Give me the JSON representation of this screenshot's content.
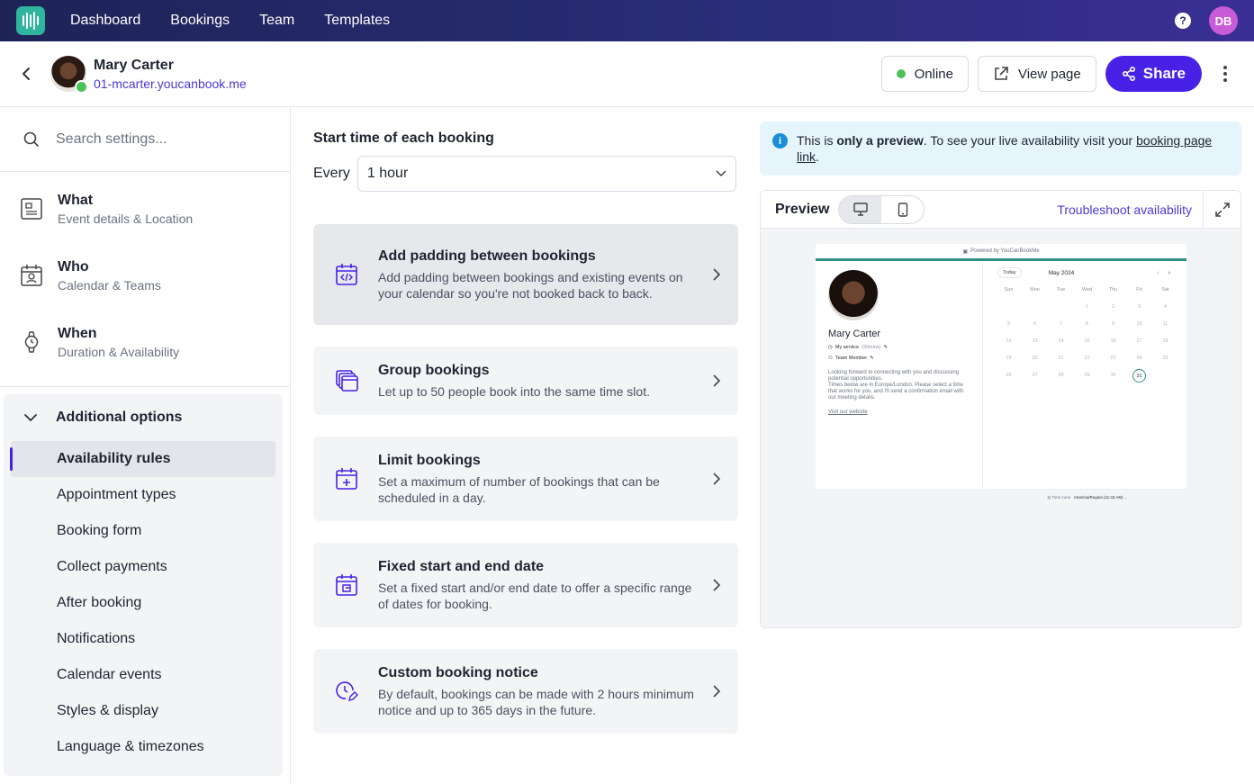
{
  "nav": {
    "links": [
      "Dashboard",
      "Bookings",
      "Team",
      "Templates"
    ],
    "help_icon": "question-circle-icon",
    "user_initials": "DB"
  },
  "header": {
    "name": "Mary Carter",
    "url": "01-mcarter.youcanbook.me",
    "online_label": "Online",
    "view_page_label": "View page",
    "share_label": "Share"
  },
  "sidebar": {
    "search_placeholder": "Search settings...",
    "sections": [
      {
        "title": "What",
        "subtitle": "Event details & Location",
        "icon": "document-icon"
      },
      {
        "title": "Who",
        "subtitle": "Calendar & Teams",
        "icon": "calendar-person-icon"
      },
      {
        "title": "When",
        "subtitle": "Duration & Availability",
        "icon": "watch-icon"
      }
    ],
    "additional_title": "Additional options",
    "options": [
      "Availability rules",
      "Appointment types",
      "Booking form",
      "Collect payments",
      "After booking",
      "Notifications",
      "Calendar events",
      "Styles & display",
      "Language & timezones"
    ],
    "active_option": "Availability rules"
  },
  "main": {
    "start_time_label": "Start time of each booking",
    "every_label": "Every",
    "every_value": "1 hour",
    "cards": [
      {
        "title": "Add padding between bookings",
        "desc": "Add padding between bookings and existing events on your calendar so you're not booked back to back.",
        "icon": "calendar-code-icon"
      },
      {
        "title": "Group bookings",
        "desc": "Let up to 50 people book into the same time slot.",
        "icon": "calendar-stack-icon"
      },
      {
        "title": "Limit bookings",
        "desc": "Set a maximum of number of bookings that can be scheduled in a day.",
        "icon": "calendar-plus-icon"
      },
      {
        "title": "Fixed start and end date",
        "desc": "Set a fixed start and/or end date to offer a specific range of dates for booking.",
        "icon": "calendar-range-icon"
      },
      {
        "title": "Custom booking notice",
        "desc": "By default, bookings can be made with 2 hours minimum notice and up to 365 days in the future.",
        "icon": "clock-edit-icon"
      }
    ]
  },
  "preview": {
    "info_prefix": "This is ",
    "info_bold": "only a preview",
    "info_middle": ". To see your live availability visit your ",
    "info_link": "booking page link",
    "info_suffix": ".",
    "title": "Preview",
    "troubleshoot_label": "Troubleshoot availability",
    "mini": {
      "powered_by": "Powered by YouCanBookMe",
      "name": "Mary Carter",
      "service_name": "My service",
      "service_duration": "(30mins)",
      "member": "Team Member",
      "desc_1": "Looking forward to connecting with you and discussing potential opportunities.",
      "desc_2": "Times below are in Europe/London. Please select a time that works for you, and I'll send a confirmation email with our meeting details.",
      "link": "Visit our website",
      "today": "Today",
      "month": "May 2024",
      "days": [
        "Sun",
        "Mon",
        "Tue",
        "Wed",
        "Thu",
        "Fri",
        "Sat"
      ],
      "dates": [
        "",
        "",
        "",
        "1",
        "2",
        "3",
        "4",
        "5",
        "6",
        "7",
        "8",
        "9",
        "10",
        "11",
        "12",
        "13",
        "14",
        "15",
        "16",
        "17",
        "18",
        "19",
        "20",
        "21",
        "22",
        "23",
        "24",
        "25",
        "26",
        "27",
        "28",
        "29",
        "30",
        "31",
        ""
      ],
      "selected_date": "31",
      "tz_label": "Time zone",
      "tz_value": "America/Regina (11:43 AM)"
    }
  },
  "colors": {
    "accent": "#4722e6",
    "link": "#4a39d6",
    "online": "#4cc35a",
    "brand_teal": "#2fb59d"
  }
}
